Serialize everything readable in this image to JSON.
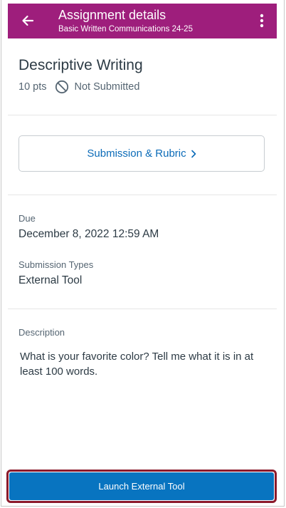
{
  "appbar": {
    "title": "Assignment details",
    "subtitle": "Basic Written Communications 24-25",
    "color": "#9e1e7c"
  },
  "assignment": {
    "name": "Descriptive Writing",
    "points": "10 pts",
    "status": "Not Submitted",
    "status_icon": "not-submitted-icon"
  },
  "submission_button": {
    "label": "Submission & Rubric"
  },
  "due": {
    "label": "Due",
    "value": "December 8, 2022 12:59 AM"
  },
  "submission_types": {
    "label": "Submission Types",
    "value": "External Tool"
  },
  "description": {
    "label": "Description",
    "text": "What is your favorite color? Tell me what it is in at least 100 words."
  },
  "launch_button": {
    "label": "Launch External Tool",
    "color": "#0874c0",
    "highlight_color": "#8b1a2b"
  }
}
